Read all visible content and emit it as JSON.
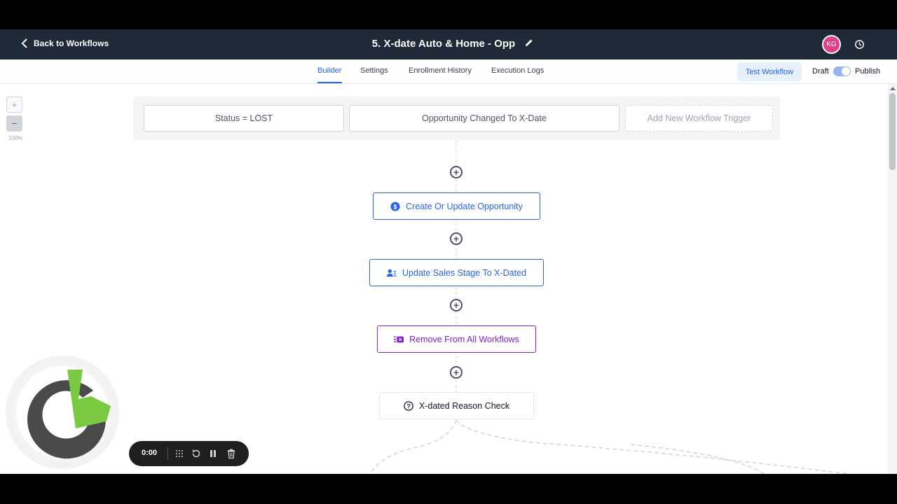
{
  "header": {
    "back_label": "Back to Workflows",
    "title": "5. X-date Auto & Home - Opp",
    "avatar_initials": "KG",
    "background": "#1f2937"
  },
  "tabs": [
    {
      "label": "Builder",
      "active": true
    },
    {
      "label": "Settings"
    },
    {
      "label": "Enrollment History"
    },
    {
      "label": "Execution Logs"
    }
  ],
  "actions": {
    "test_label": "Test Workflow",
    "draft_label": "Draft",
    "publish_label": "Publish",
    "accent": "#2563eb"
  },
  "zoom": {
    "plus": "+",
    "minus": "−",
    "level": "100%"
  },
  "triggers": [
    {
      "label": "Status = LOST"
    },
    {
      "label": "Opportunity Changed To X-Date"
    },
    {
      "label": "Add New Workflow Trigger"
    }
  ],
  "steps": [
    {
      "label": "Create Or Update Opportunity",
      "icon": "dollar-icon"
    },
    {
      "label": "Update Sales Stage To X-Dated",
      "icon": "user-list-icon"
    },
    {
      "label": "Remove From All Workflows",
      "icon": "remove-workflow-icon"
    },
    {
      "label": "X-dated Reason Check",
      "icon": "question-icon"
    }
  ],
  "recorder": {
    "time": "0:00"
  }
}
